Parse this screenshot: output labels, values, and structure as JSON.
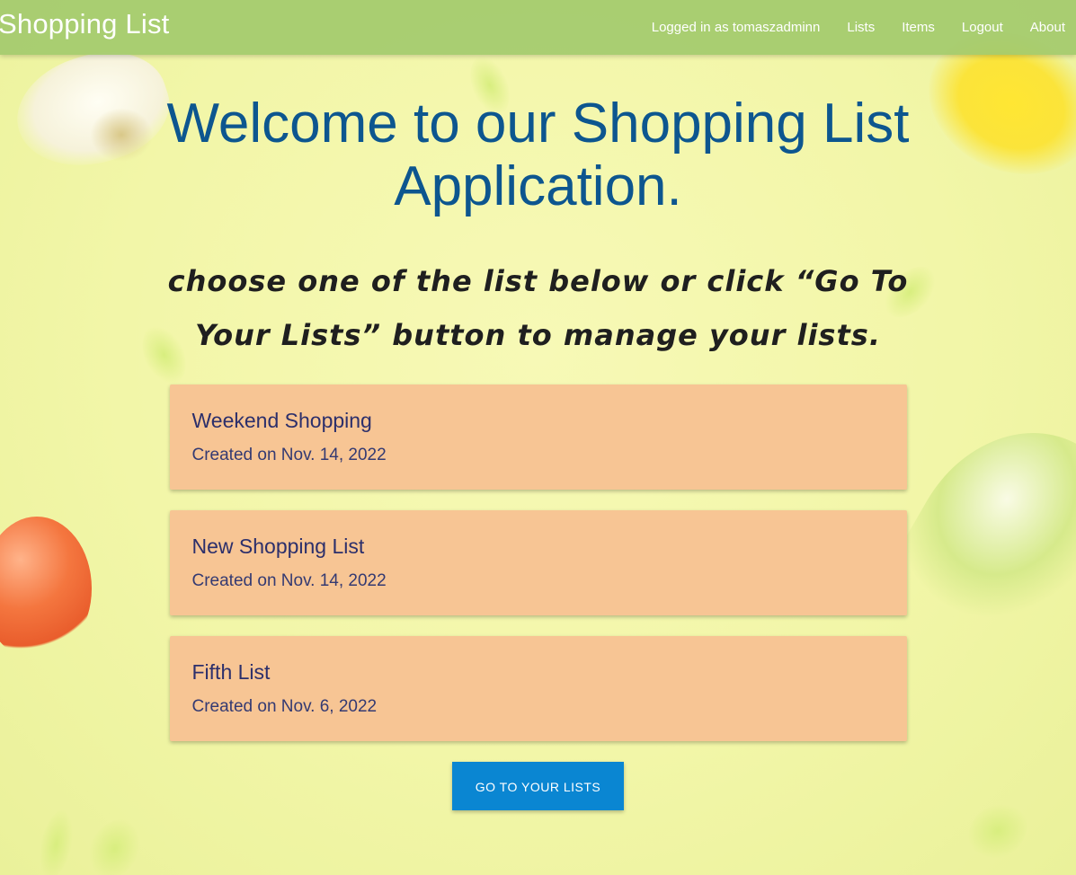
{
  "navbar": {
    "brand": "Shopping List",
    "logged_in": "Logged in as tomaszadminn",
    "links": [
      "Lists",
      "Items",
      "Logout",
      "About"
    ]
  },
  "main": {
    "welcome": "Welcome to our Shopping List Application.",
    "subtitle": "choose one of the list below or click “Go To Your Lists” button to manage your lists.",
    "lists": [
      {
        "title": "Weekend Shopping",
        "date": "Created on Nov. 14, 2022"
      },
      {
        "title": "New Shopping List",
        "date": "Created on Nov. 14, 2022"
      },
      {
        "title": "Fifth List",
        "date": "Created on Nov. 6, 2022"
      }
    ],
    "button_label": "GO TO YOUR LISTS"
  },
  "colors": {
    "navbar": "#a3ca6c",
    "heading": "#0d568f",
    "card": "#f7c594",
    "button": "#0a86d2"
  }
}
